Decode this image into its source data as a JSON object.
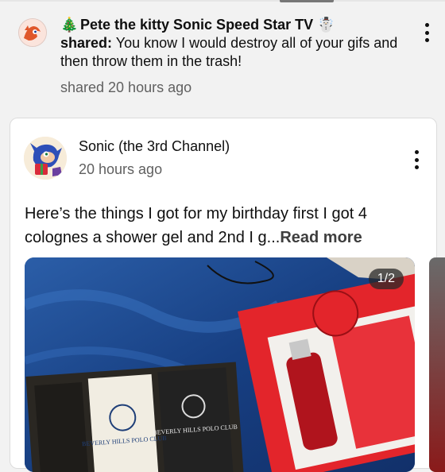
{
  "shared_post": {
    "tree_emoji": "🎄",
    "author": "Pete the kitty Sonic Speed Star TV",
    "snowman_emoji": "☃️",
    "shared_label": "shared:",
    "message": "You know I would destroy all of your gifs and then throw them in the trash!",
    "time": "shared 20 hours ago"
  },
  "post": {
    "channel": "Sonic (the 3rd Channel)",
    "time": "20 hours ago",
    "text": "Here’s the things I got for my birthday first I got 4 colognes a shower gel and 2nd I g...",
    "read_more": "Read more",
    "image_counter": "1/2",
    "box_labels": [
      "BEVERLY HILLS POLO CLUB",
      "BEVERLY HILLS POLO CLUB"
    ]
  },
  "colors": {
    "blanket": "#1d4a8a",
    "gift_box": "#e3252b",
    "cologne_box": "#2a2722"
  },
  "icons": {
    "menu": "more-vert-icon"
  }
}
